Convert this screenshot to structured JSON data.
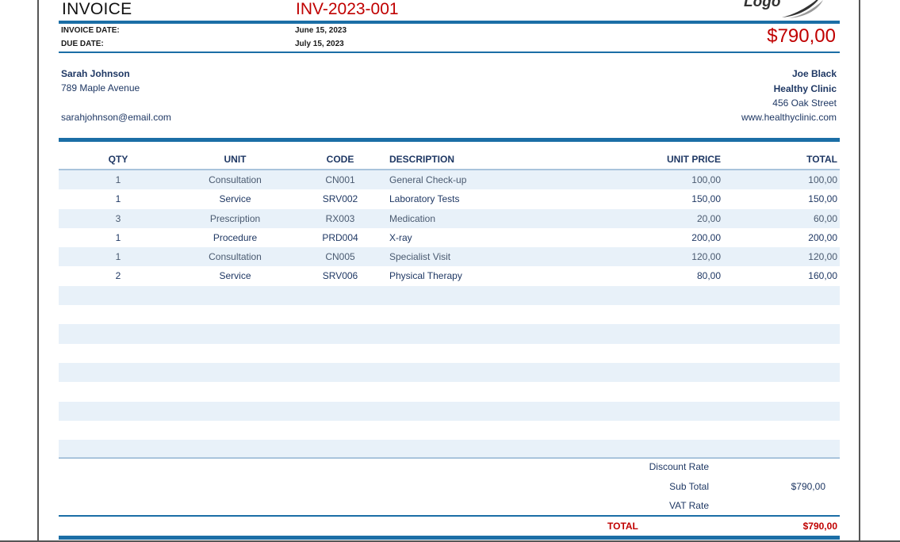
{
  "invoice": {
    "title": "INVOICE",
    "number": "INV-2023-001",
    "invoice_date_label": "INVOICE DATE:",
    "invoice_date": "June 15, 2023",
    "due_date_label": "DUE DATE:",
    "due_date": "July 15, 2023",
    "amount_due": "$790,00",
    "logo_text": "Logo"
  },
  "client": {
    "name": "Sarah Johnson",
    "street": "789 Maple Avenue",
    "email": "sarahjohnson@email.com"
  },
  "provider": {
    "contact": "Joe Black",
    "company": "Healthy Clinic",
    "street": "456 Oak Street",
    "website": "www.healthyclinic.com"
  },
  "table": {
    "headers": {
      "qty": "QTY",
      "unit": "UNIT",
      "code": "CODE",
      "description": "DESCRIPTION",
      "unit_price": "UNIT PRICE",
      "total": "TOTAL"
    },
    "rows": [
      {
        "qty": "1",
        "unit": "Consultation",
        "code": "CN001",
        "description": "General Check-up",
        "unit_price": "100,00",
        "total": "100,00"
      },
      {
        "qty": "1",
        "unit": "Service",
        "code": "SRV002",
        "description": "Laboratory Tests",
        "unit_price": "150,00",
        "total": "150,00"
      },
      {
        "qty": "3",
        "unit": "Prescription",
        "code": "RX003",
        "description": "Medication",
        "unit_price": "20,00",
        "total": "60,00"
      },
      {
        "qty": "1",
        "unit": "Procedure",
        "code": "PRD004",
        "description": "X-ray",
        "unit_price": "200,00",
        "total": "200,00"
      },
      {
        "qty": "1",
        "unit": "Consultation",
        "code": "CN005",
        "description": "Specialist Visit",
        "unit_price": "120,00",
        "total": "120,00"
      },
      {
        "qty": "2",
        "unit": "Service",
        "code": "SRV006",
        "description": "Physical Therapy",
        "unit_price": "80,00",
        "total": "160,00"
      },
      {
        "qty": "",
        "unit": "",
        "code": "",
        "description": "",
        "unit_price": "",
        "total": ""
      },
      {
        "qty": "",
        "unit": "",
        "code": "",
        "description": "",
        "unit_price": "",
        "total": ""
      },
      {
        "qty": "",
        "unit": "",
        "code": "",
        "description": "",
        "unit_price": "",
        "total": ""
      },
      {
        "qty": "",
        "unit": "",
        "code": "",
        "description": "",
        "unit_price": "",
        "total": ""
      },
      {
        "qty": "",
        "unit": "",
        "code": "",
        "description": "",
        "unit_price": "",
        "total": ""
      },
      {
        "qty": "",
        "unit": "",
        "code": "",
        "description": "",
        "unit_price": "",
        "total": ""
      },
      {
        "qty": "",
        "unit": "",
        "code": "",
        "description": "",
        "unit_price": "",
        "total": ""
      },
      {
        "qty": "",
        "unit": "",
        "code": "",
        "description": "",
        "unit_price": "",
        "total": ""
      },
      {
        "qty": "",
        "unit": "",
        "code": "",
        "description": "",
        "unit_price": "",
        "total": ""
      },
      {
        "qty": "",
        "unit": "",
        "code": "",
        "description": "",
        "unit_price": "",
        "total": ""
      }
    ]
  },
  "summary": {
    "discount_label": "Discount Rate",
    "discount_value": "",
    "subtotal_label": "Sub Total",
    "subtotal_value": "$790,00",
    "vat_label": "VAT Rate",
    "vat_value": "",
    "total_label": "TOTAL",
    "total_value": "$790,00"
  },
  "colors": {
    "accent": "#1b6ea6",
    "alert": "#c00000",
    "row_alt": "#e8f1f9",
    "text": "#1f3864"
  }
}
